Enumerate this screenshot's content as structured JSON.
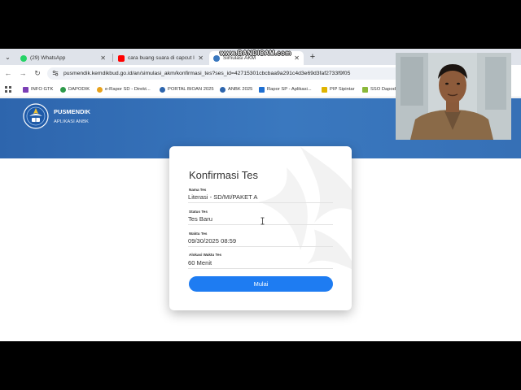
{
  "browser": {
    "tabs": [
      {
        "label": "(29) WhatsApp",
        "close": "✕",
        "favicon_color": "#25d366"
      },
      {
        "label": "cara buang suara di capcut lep",
        "close": "✕",
        "favicon_color": "#ff0000"
      },
      {
        "label": "Simulasi AKM",
        "close": "✕",
        "favicon_color": "#3a78bf"
      }
    ],
    "new_tab": "+",
    "tab_list": "⌄",
    "recorder_watermark": "www.BANDICAM.com",
    "nav": {
      "back": "←",
      "forward": "→",
      "reload": "↻",
      "home": "⌂"
    },
    "url": "pusmendik.kemdikbud.go.id/an/simulasi_akm/konfirmasi_tes?ses_id=42715301cbcbaa9a291c4d3e69d3faf2733f9f05",
    "bookmarks": [
      {
        "label": "INFO GTK",
        "color": "#7b3fb5"
      },
      {
        "label": "DAPODIK",
        "color": "#2e9a4a"
      },
      {
        "label": "e-Rapor SD - Direkt...",
        "color": "#e8a21c"
      },
      {
        "label": "PORTAL BIOAN 2025",
        "color": "#2d65ad"
      },
      {
        "label": "ANBK 2025",
        "color": "#2d65ad"
      },
      {
        "label": "Rapor SP - Aplikasi...",
        "color": "#1f6fd1"
      },
      {
        "label": "PIP Sipintar",
        "color": "#e0b400"
      },
      {
        "label": "SSO Dapodik",
        "color": "#8bb83a"
      }
    ]
  },
  "header": {
    "brand": "PUSMENDIK",
    "subtitle": "APLIKASI ANBK",
    "banner_color": "#3a78bf"
  },
  "form": {
    "title": "Konfirmasi Tes",
    "fields": [
      {
        "label": "Nama Tes",
        "value": "Literasi - SD/MI/PAKET A"
      },
      {
        "label": "Status Tes",
        "value": "Tes Baru"
      },
      {
        "label": "Waktu Tes",
        "value": "09/30/2025 08:59"
      },
      {
        "label": "Alokasi Waktu Tes",
        "value": "60 Menit"
      }
    ],
    "submit_label": "Mulai",
    "accent_color": "#1e7cf2"
  }
}
